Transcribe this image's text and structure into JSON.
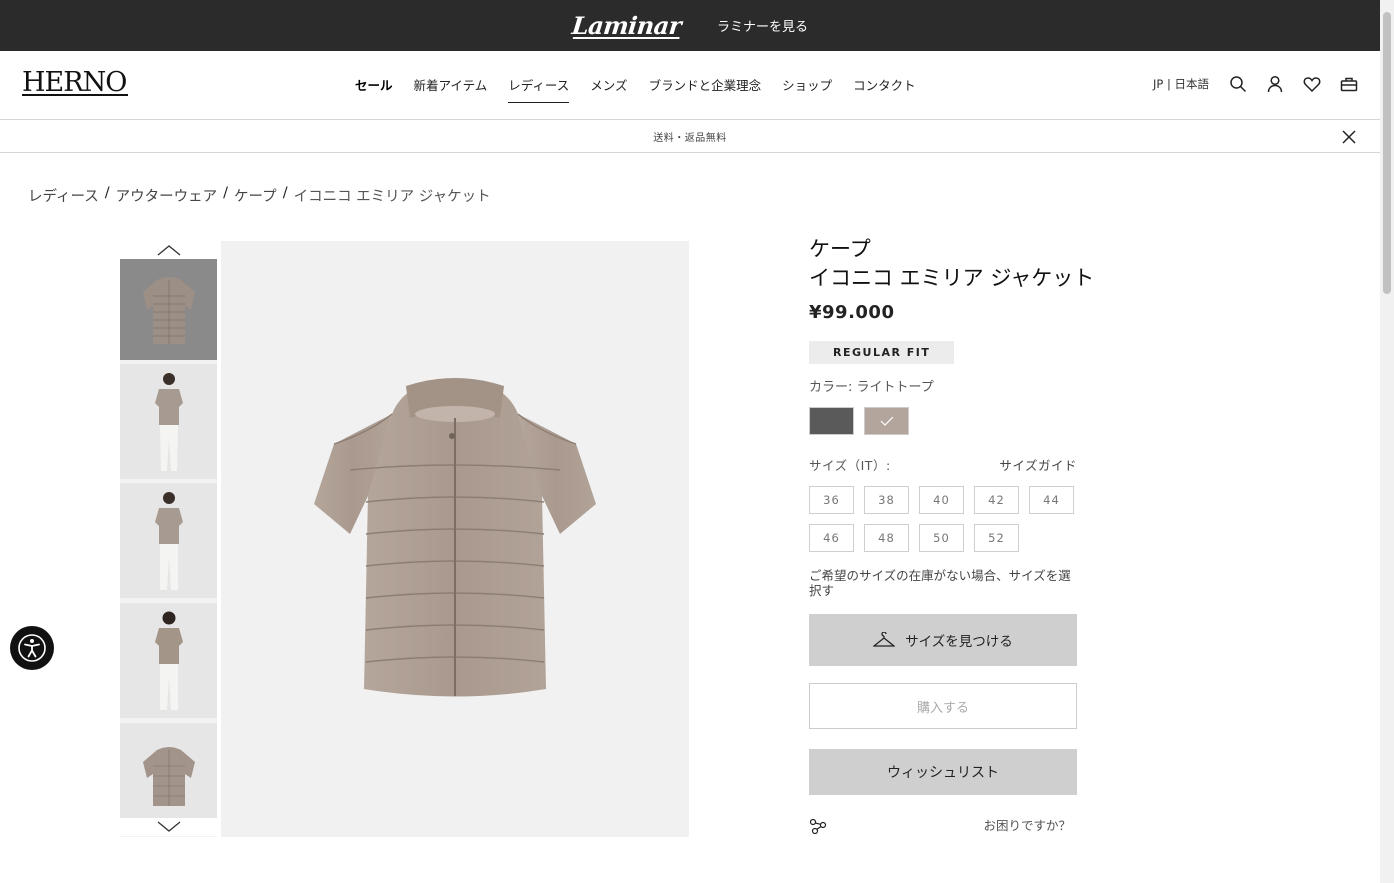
{
  "topbar": {
    "logo_text": "Laminar",
    "link_label": "ラミナーを見る"
  },
  "header": {
    "brand": "HERNO",
    "nav": [
      {
        "label": "セール"
      },
      {
        "label": "新着アイテム"
      },
      {
        "label": "レディース"
      },
      {
        "label": "メンズ"
      },
      {
        "label": "ブランドと企業理念"
      },
      {
        "label": "ショップ"
      },
      {
        "label": "コンタクト"
      }
    ],
    "active_nav": "レディース",
    "language": "JP | 日本語",
    "icons": [
      "search-icon",
      "account-icon",
      "heart-icon",
      "bag-icon"
    ]
  },
  "shipping_bar": {
    "text": "送料・返品無料",
    "close_icon": "close-icon"
  },
  "breadcrumb": {
    "items": [
      "レディース",
      "アウターウェア",
      "ケープ"
    ],
    "separator": "/",
    "current": "イコニコ エミリア ジャケット"
  },
  "gallery": {
    "thumb_count": 5,
    "selected_index": 0
  },
  "product": {
    "category": "ケープ",
    "name": "イコニコ エミリア ジャケット",
    "price": "¥99.000",
    "fit": "REGULAR FIT",
    "color_label": "カラー: ライトトープ",
    "colors": [
      {
        "name": "dark-grey",
        "hex": "#5a5a5a",
        "selected": false
      },
      {
        "name": "light-taupe",
        "hex": "#b3a59b",
        "selected": true
      }
    ],
    "size_label": "サイズ（IT）:",
    "size_guide": "サイズガイド",
    "sizes": [
      "36",
      "38",
      "40",
      "42",
      "44",
      "46",
      "48",
      "50",
      "52"
    ],
    "note": "ご希望のサイズの在庫がない場合、サイズを選択す",
    "find_size_button": "サイズを見つける",
    "buy_button": "購入する",
    "wishlist_button": "ウィッシュリスト",
    "help_link": "お困りですか？"
  },
  "colors": {
    "topbar": "#2b2b2b",
    "button_grey": "#cfcfcf",
    "image_bg": "#f1f1f1"
  }
}
